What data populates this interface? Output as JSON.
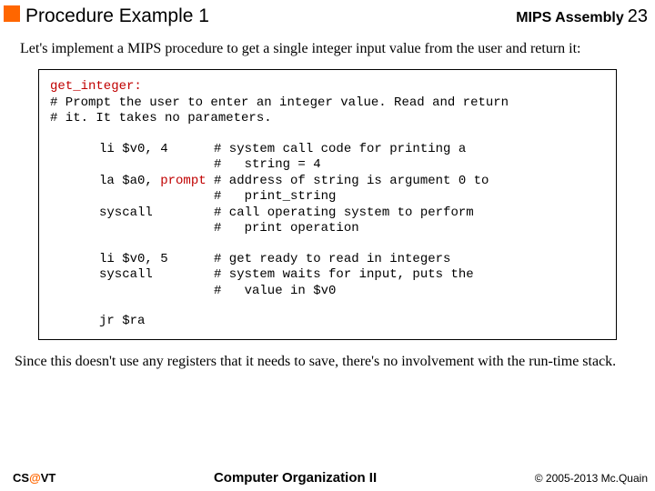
{
  "header": {
    "title": "Procedure Example 1",
    "subheading": "MIPS Assembly",
    "page_num": "23"
  },
  "intro": "Let's implement a MIPS procedure to get a single integer input value from the user and return it:",
  "code": {
    "label": "get_integer:",
    "comment1": "# Prompt the user to enter an integer value.  Read and return",
    "comment2": "# it.  It takes no parameters.",
    "rows": [
      {
        "instr": "li $v0, 4",
        "cmt": "# system call code for printing a"
      },
      {
        "instr": "",
        "cmt": "#   string = 4"
      },
      {
        "instr": "la $a0, ",
        "sym": "prompt",
        "cmt": "# address of string is argument 0 to"
      },
      {
        "instr": "",
        "cmt": "#   print_string"
      },
      {
        "instr": "syscall",
        "cmt": "# call operating system to perform"
      },
      {
        "instr": "",
        "cmt": "#   print operation"
      }
    ],
    "rows2": [
      {
        "instr": "li $v0, 5",
        "cmt": "# get ready to read in integers"
      },
      {
        "instr": "syscall",
        "cmt": "# system waits for input, puts the"
      },
      {
        "instr": "",
        "cmt": "#   value in $v0"
      }
    ],
    "jr": "jr $ra"
  },
  "outro": "Since this doesn't use any registers that it needs to save, there's no involvement with the run-time stack.",
  "footer": {
    "left_pre": "CS",
    "left_at": "@",
    "left_post": "VT",
    "center": "Computer Organization II",
    "right": "© 2005-2013 Mc.Quain"
  }
}
